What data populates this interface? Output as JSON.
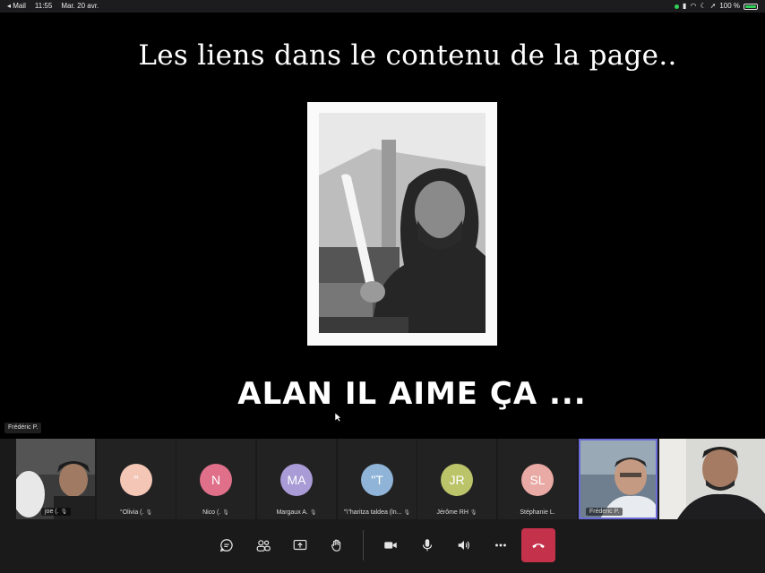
{
  "statusbar": {
    "back_app": "◂ Mail",
    "time": "11:55",
    "date": "Mar. 20 avr.",
    "battery": "100 %"
  },
  "share": {
    "title": "Les liens dans le contenu  de la page..",
    "caption": "Alan il aime ça ...",
    "presenter_tag": "Frédéric P."
  },
  "participants": [
    {
      "name": "joe (.",
      "type": "video"
    },
    {
      "name": "°Olivia (.",
      "initials": "\"",
      "color": "#f3c6b6"
    },
    {
      "name": "Nico (.",
      "initials": "N",
      "color": "#e0708a"
    },
    {
      "name": "Margaux A.",
      "initials": "MA",
      "color": "#a89bd6"
    },
    {
      "name": "\"\\\"haritza taldea (ln...",
      "initials": "\"T",
      "color": "#8fb4d8"
    },
    {
      "name": "Jérôme RH",
      "initials": "JR",
      "color": "#bcc46a"
    },
    {
      "name": "Stéphanie L.",
      "initials": "SL",
      "color": "#e9a9a4"
    },
    {
      "name": "Frédéric P.",
      "type": "video",
      "active": true
    },
    {
      "name": "",
      "type": "video"
    }
  ],
  "controls": {
    "items": [
      "chat-icon",
      "participants-icon",
      "share-screen-icon",
      "raise-hand-icon",
      "camera-icon",
      "microphone-icon",
      "speaker-icon",
      "more-icon",
      "hang-up-icon"
    ],
    "hangup_color": "#c4314b"
  }
}
